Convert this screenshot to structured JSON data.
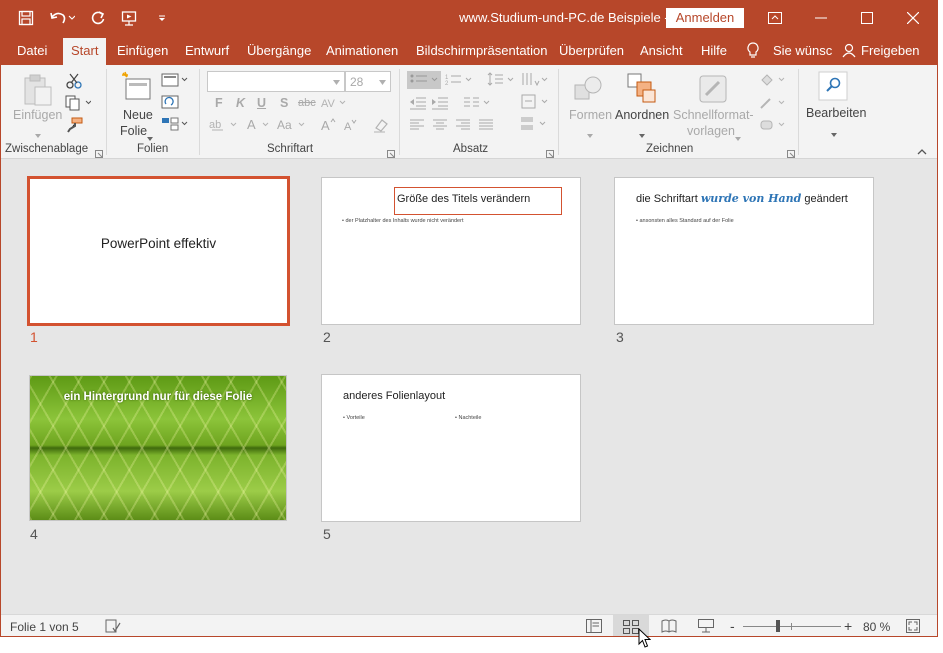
{
  "window": {
    "title": "www.Studium-und-PC.de  Beispiele  -  PowerPoint",
    "signin_label": "Anmelden"
  },
  "tabs": [
    "Datei",
    "Start",
    "Einfügen",
    "Entwurf",
    "Übergänge",
    "Animationen",
    "Bildschirmpräsentation",
    "Überprüfen",
    "Ansicht",
    "Hilfe"
  ],
  "active_tab": "Start",
  "tell_me": "Sie wünsc",
  "share_label": "Freigeben",
  "ribbon": {
    "clipboard": {
      "paste_label": "Einfügen",
      "group_label": "Zwischenablage"
    },
    "slides": {
      "new_slide_label_1": "Neue",
      "new_slide_label_2": "Folie",
      "group_label": "Folien"
    },
    "font": {
      "font_name": "",
      "font_size": "28",
      "bold": "F",
      "italic": "K",
      "underline": "U",
      "shadow": "S",
      "strike": "abc",
      "group_label": "Schriftart"
    },
    "paragraph": {
      "group_label": "Absatz"
    },
    "drawing": {
      "shapes_label": "Formen",
      "arrange_label": "Anordnen",
      "quickstyles_label_1": "Schnellformat-",
      "quickstyles_label_2": "vorlagen",
      "group_label": "Zeichnen"
    },
    "editing": {
      "label": "Bearbeiten"
    }
  },
  "slides": [
    {
      "number": "1",
      "title": "PowerPoint effektiv",
      "selected": true
    },
    {
      "number": "2",
      "title": "Größe des Titels verändern",
      "bullet": "der Platzhalter des Inhalts wurde nicht verändert"
    },
    {
      "number": "3",
      "title_part1": "die Schriftart ",
      "title_part2": "wurde von Hand",
      "title_part3": " geändert",
      "bullet": "ansonsten alles Standard auf der Folie"
    },
    {
      "number": "4",
      "title": "ein Hintergrund nur für diese Folie"
    },
    {
      "number": "5",
      "title": "anderes Folienlayout",
      "bullet_left": "Vorteile",
      "bullet_right": "Nachteile"
    }
  ],
  "status": {
    "slide_info": "Folie 1 von 5",
    "zoom_level": "80 %",
    "zoom_minus": "-",
    "zoom_plus": "+"
  },
  "colors": {
    "accent": "#b7472a",
    "selection": "#d35230",
    "handwriting": "#2e75b6"
  }
}
